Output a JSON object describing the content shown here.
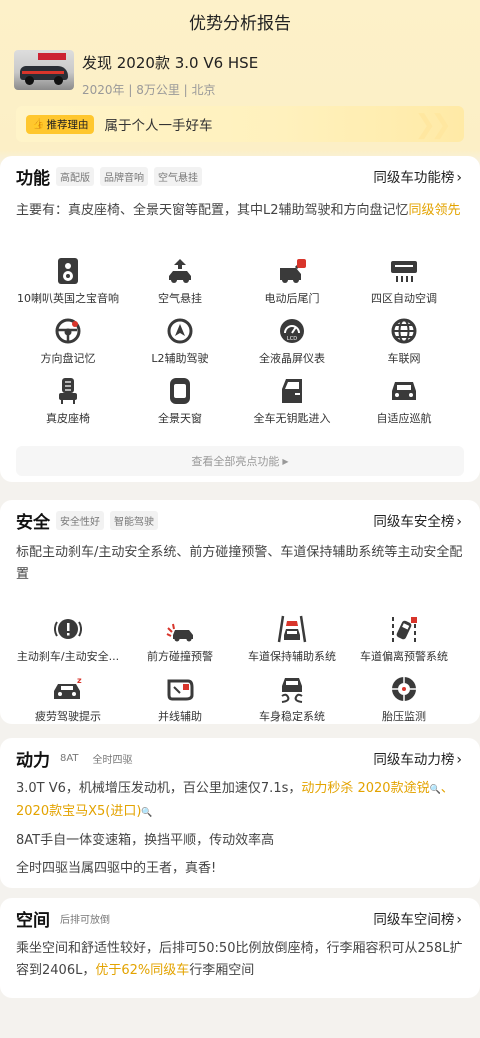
{
  "page_title": "优势分析报告",
  "car": {
    "name": "发现 2020款 3.0 V6 HSE",
    "meta": "2020年 | 8万公里 | 北京"
  },
  "reason": {
    "badge": "推荐理由",
    "text": "属于个人一手好车"
  },
  "function_section": {
    "title": "功能",
    "tags": [
      "高配版",
      "品牌音响",
      "空气悬挂"
    ],
    "rank_link": "同级车功能榜",
    "desc_prefix": "主要有：真皮座椅、全景天窗等配置，其中L2辅助驾驶和方向盘记忆",
    "desc_highlight": "同级领先",
    "items": [
      {
        "label": "10喇叭英国之宝音响",
        "icon": "speaker-icon"
      },
      {
        "label": "空气悬挂",
        "icon": "air-suspension-icon"
      },
      {
        "label": "电动后尾门",
        "icon": "power-tailgate-icon"
      },
      {
        "label": "四区自动空调",
        "icon": "climate-control-icon"
      },
      {
        "label": "方向盘记忆",
        "icon": "steering-memory-icon"
      },
      {
        "label": "L2辅助驾驶",
        "icon": "l2-assist-icon"
      },
      {
        "label": "全液晶屏仪表",
        "icon": "lcd-dashboard-icon"
      },
      {
        "label": "车联网",
        "icon": "globe-icon"
      },
      {
        "label": "真皮座椅",
        "icon": "seat-icon"
      },
      {
        "label": "全景天窗",
        "icon": "sunroof-icon"
      },
      {
        "label": "全车无钥匙进入",
        "icon": "keyless-entry-icon"
      },
      {
        "label": "自适应巡航",
        "icon": "adaptive-cruise-icon"
      }
    ],
    "see_all": "查看全部亮点功能"
  },
  "safety_section": {
    "title": "安全",
    "tags": [
      "安全性好",
      "智能驾驶"
    ],
    "rank_link": "同级车安全榜",
    "desc": "标配主动刹车/主动安全系统、前方碰撞预警、车道保持辅助系统等主动安全配置",
    "items": [
      {
        "label": "主动刹车/主动安全...",
        "icon": "active-brake-icon"
      },
      {
        "label": "前方碰撞预警",
        "icon": "collision-warning-icon"
      },
      {
        "label": "车道保持辅助系统",
        "icon": "lane-keep-icon"
      },
      {
        "label": "车道偏离预警系统",
        "icon": "lane-departure-icon"
      },
      {
        "label": "疲劳驾驶提示",
        "icon": "fatigue-alert-icon"
      },
      {
        "label": "并线辅助",
        "icon": "blind-spot-icon"
      },
      {
        "label": "车身稳定系统",
        "icon": "stability-control-icon"
      },
      {
        "label": "胎压监测",
        "icon": "tire-pressure-icon"
      }
    ]
  },
  "power_section": {
    "title": "动力",
    "tags": [
      "8AT",
      "全时四驱"
    ],
    "rank_link": "同级车动力榜",
    "line1_prefix": "3.0T V6，机械增压发动机，百公里加速仅7.1s，",
    "line1_hl1": "动力秒杀 2020款途锐",
    "line1_sep": "、",
    "line1_hl2": "2020款宝马X5(进口)",
    "line2": "8AT手自一体变速箱，换挡平顺，传动效率高",
    "line3": "全时四驱当属四驱中的王者，真香!"
  },
  "space_section": {
    "title": "空间",
    "tags": [
      "后排可放倒"
    ],
    "rank_link": "同级车空间榜",
    "desc_prefix": "乘坐空间和舒适性较好，后排可50:50比例放倒座椅，行李厢容积可从258L扩容到2406L，",
    "desc_highlight": "优于62%同级车",
    "desc_suffix": "行李厢空间"
  }
}
